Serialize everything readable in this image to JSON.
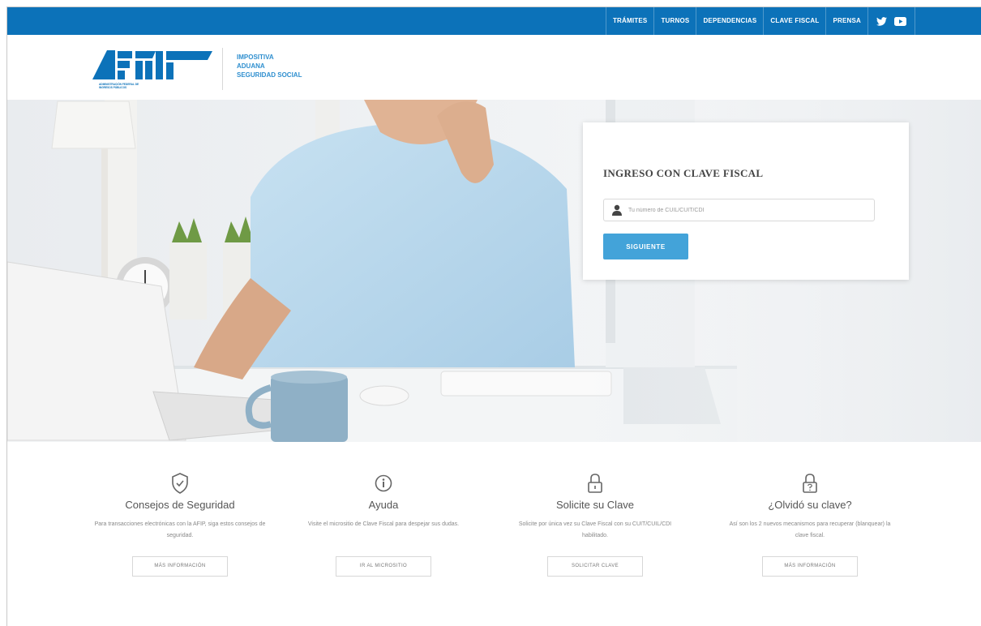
{
  "header": {
    "nav": [
      "TRÁMITES",
      "TURNOS",
      "DEPENDENCIAS",
      "CLAVE FISCAL",
      "PRENSA"
    ],
    "social_icons": [
      "twitter-icon",
      "youtube-icon"
    ],
    "logo_text": "AFIP",
    "logo_subtitle": "ADMINISTRACIÓN FEDERAL DE INGRESOS PÚBLICOS",
    "tagline": [
      "IMPOSITIVA",
      "ADUANA",
      "SEGURIDAD SOCIAL"
    ],
    "brand_color": "#0c72b9"
  },
  "login": {
    "title": "INGRESO CON CLAVE FISCAL",
    "input_placeholder": "Tu número de CUIL/CUIT/CDI",
    "input_value": "",
    "submit_label": "SIGUIENTE",
    "button_color": "#43a3d9"
  },
  "features": [
    {
      "icon": "shield-check-icon",
      "title": "Consejos de Seguridad",
      "description": "Para transacciones electrónicas con la AFIP, siga estos consejos de seguridad.",
      "button": "MÁS INFORMACIÓN"
    },
    {
      "icon": "info-icon",
      "title": "Ayuda",
      "description": "Visite el micrositio de Clave Fiscal para despejar sus dudas.",
      "button": "IR AL MICROSITIO"
    },
    {
      "icon": "padlock-icon",
      "title": "Solicite su Clave",
      "description": "Solicite por única vez su Clave Fiscal con su CUIT/CUIL/CDI habilitado.",
      "button": "SOLICITAR CLAVE"
    },
    {
      "icon": "padlock-question-icon",
      "title": "¿Olvidó su clave?",
      "description": "Así son los 2 nuevos mecanismos para recuperar (blanquear) la clave fiscal.",
      "button": "MÁS INFORMACIÓN"
    }
  ]
}
